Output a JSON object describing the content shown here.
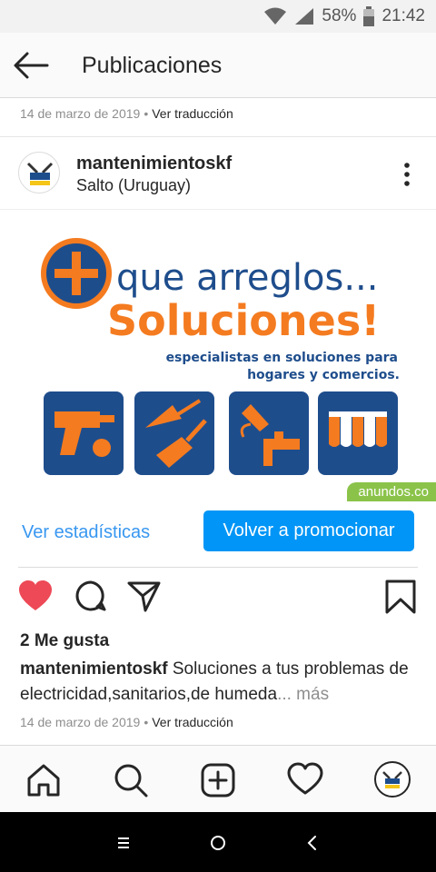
{
  "status_bar": {
    "battery_percent": "58%",
    "time": "21:42"
  },
  "header": {
    "title": "Publicaciones"
  },
  "previous_post_meta": {
    "date": "14 de marzo de 2019",
    "separator": "•",
    "translate": "Ver traducción"
  },
  "post": {
    "username": "mantenimientoskf",
    "location": "Salto (Uruguay)",
    "image": {
      "line1": "que arreglos...",
      "line2": "Soluciones!",
      "tagline1": "especialistas en soluciones para",
      "tagline2": "hogares y comercios.",
      "watermark": "anundos.co"
    },
    "stats_link": "Ver estadísticas",
    "promote_button": "Volver a promocionar",
    "likes": "2 Me gusta",
    "caption_user": "mantenimientoskf",
    "caption_text": " Soluciones a tus problemas de electricidad,sanitarios,de humeda",
    "caption_more_ellipsis": "...",
    "caption_more": " más",
    "date": "14 de marzo de 2019",
    "separator": "•",
    "translate": "Ver traducción"
  },
  "colors": {
    "like": "#ed4956",
    "primary_button": "#0095f6",
    "link": "#3897f0",
    "brand_blue": "#1e4d8c",
    "brand_orange": "#f47b20"
  },
  "icons": [
    "back-arrow-icon",
    "more-options-icon",
    "heart-icon",
    "comment-icon",
    "share-icon",
    "bookmark-icon",
    "home-icon",
    "search-icon",
    "add-icon",
    "activity-icon"
  ]
}
